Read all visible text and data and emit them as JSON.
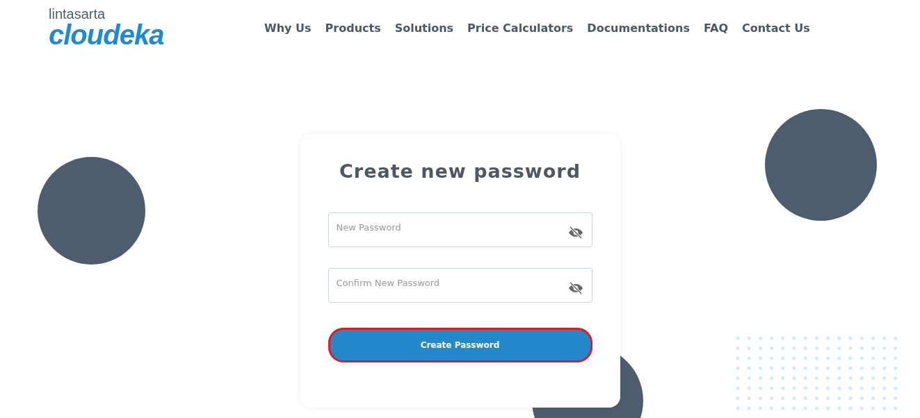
{
  "logo": {
    "company": "lintasarta",
    "brand": "cloudeka"
  },
  "nav": [
    {
      "label": "Why Us"
    },
    {
      "label": "Products"
    },
    {
      "label": "Solutions"
    },
    {
      "label": "Price Calculators"
    },
    {
      "label": "Documentations"
    },
    {
      "label": "FAQ"
    },
    {
      "label": "Contact Us"
    }
  ],
  "form": {
    "title": "Create new password",
    "fields": [
      {
        "placeholder": "New Password"
      },
      {
        "placeholder": "Confirm New Password"
      }
    ],
    "submit": {
      "label": "Create Password",
      "focused": true
    }
  }
}
